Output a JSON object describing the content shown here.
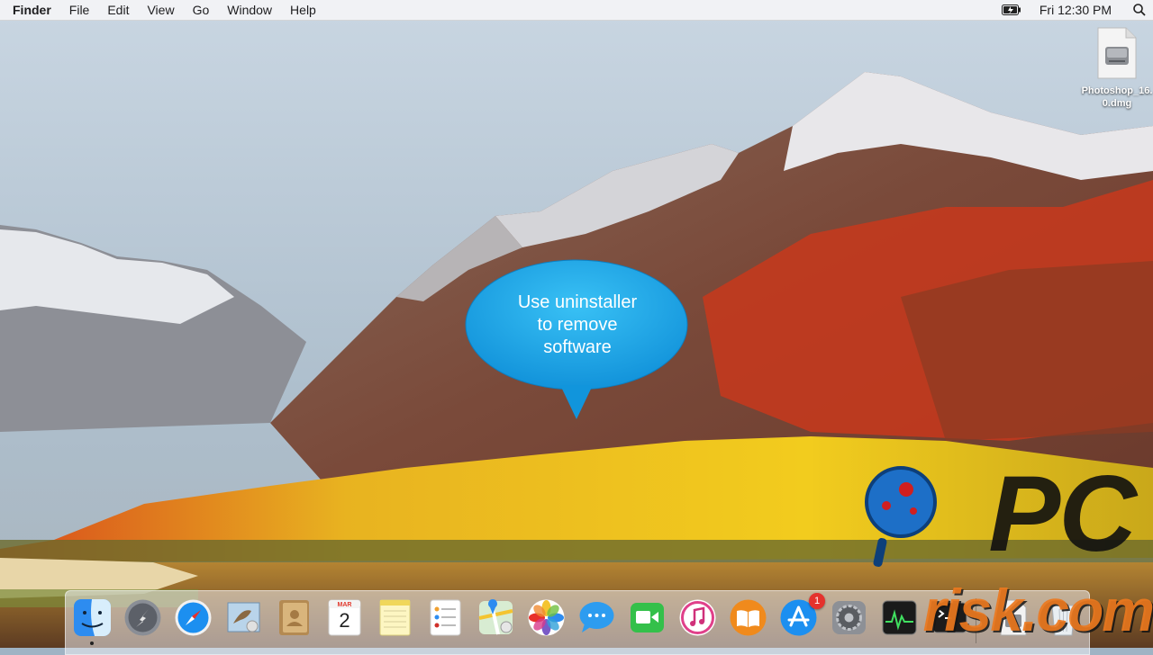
{
  "menubar": {
    "app_name": "Finder",
    "menus": [
      "File",
      "Edit",
      "View",
      "Go",
      "Window",
      "Help"
    ],
    "clock": "Fri 12:30 PM",
    "status_icons": [
      "battery-charging-icon",
      "spotlight-search-icon"
    ]
  },
  "desktop": {
    "files": [
      {
        "label": "Photoshop_16.0.dmg",
        "icon": "disk-image-icon"
      }
    ]
  },
  "callout": {
    "text": "Use uninstaller\nto remove\nsoftware",
    "color": "#1aa3e8"
  },
  "watermark": {
    "brand_top": "PC",
    "brand_bottom": "risk.com",
    "accent": "#ee7a1f"
  },
  "dock": {
    "items": [
      {
        "name": "finder-icon",
        "running": true
      },
      {
        "name": "launchpad-icon"
      },
      {
        "name": "safari-icon"
      },
      {
        "name": "mail-icon"
      },
      {
        "name": "contacts-icon"
      },
      {
        "name": "calendar-icon",
        "month": "MAR",
        "day": "2"
      },
      {
        "name": "notes-icon"
      },
      {
        "name": "reminders-icon"
      },
      {
        "name": "maps-icon"
      },
      {
        "name": "photos-icon"
      },
      {
        "name": "messages-icon"
      },
      {
        "name": "facetime-icon"
      },
      {
        "name": "itunes-icon"
      },
      {
        "name": "ibooks-icon"
      },
      {
        "name": "app-store-icon",
        "badge": "1"
      },
      {
        "name": "system-preferences-icon"
      },
      {
        "name": "activity-monitor-icon"
      },
      {
        "name": "terminal-icon"
      },
      {
        "name": "document-icon"
      },
      {
        "name": "trash-icon"
      }
    ]
  }
}
